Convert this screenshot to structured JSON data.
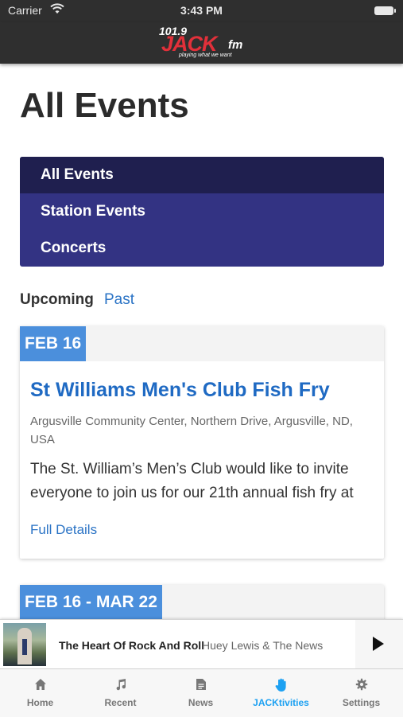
{
  "status_bar": {
    "carrier": "Carrier",
    "time": "3:43 PM"
  },
  "brand": {
    "number": "101.9",
    "name": "JACK",
    "suffix": "fm",
    "tagline": "playing what we want"
  },
  "page": {
    "title": "All Events"
  },
  "filters": [
    {
      "label": "All Events",
      "active": true
    },
    {
      "label": "Station Events",
      "active": false
    },
    {
      "label": "Concerts",
      "active": false
    }
  ],
  "toggle": {
    "upcoming": "Upcoming",
    "past": "Past"
  },
  "events": [
    {
      "date": "FEB 16",
      "title": "St Williams Men's Club Fish Fry",
      "location": "Argusville Community Center, Northern Drive, Argusville, ND, USA",
      "description": "The St. William’s Men’s Club would like to invite everyone to join us for our 21th annual fish fry at",
      "link": "Full Details"
    },
    {
      "date": "FEB 16 - MAR 22"
    }
  ],
  "now_playing": {
    "title": "The Heart Of Rock And Roll",
    "artist": "Huey Lewis & The News"
  },
  "tabs": [
    {
      "label": "Home",
      "icon": "home-icon"
    },
    {
      "label": "Recent",
      "icon": "music-note-icon"
    },
    {
      "label": "News",
      "icon": "document-icon"
    },
    {
      "label": "JACKtivities",
      "icon": "hand-icon",
      "active": true
    },
    {
      "label": "Settings",
      "icon": "gear-icon"
    }
  ],
  "colors": {
    "accent": "#1da1f2",
    "menu": "#333383",
    "menu_active": "#1f1f4f",
    "date_badge": "#4b8fdc",
    "link": "#2a73c5"
  }
}
